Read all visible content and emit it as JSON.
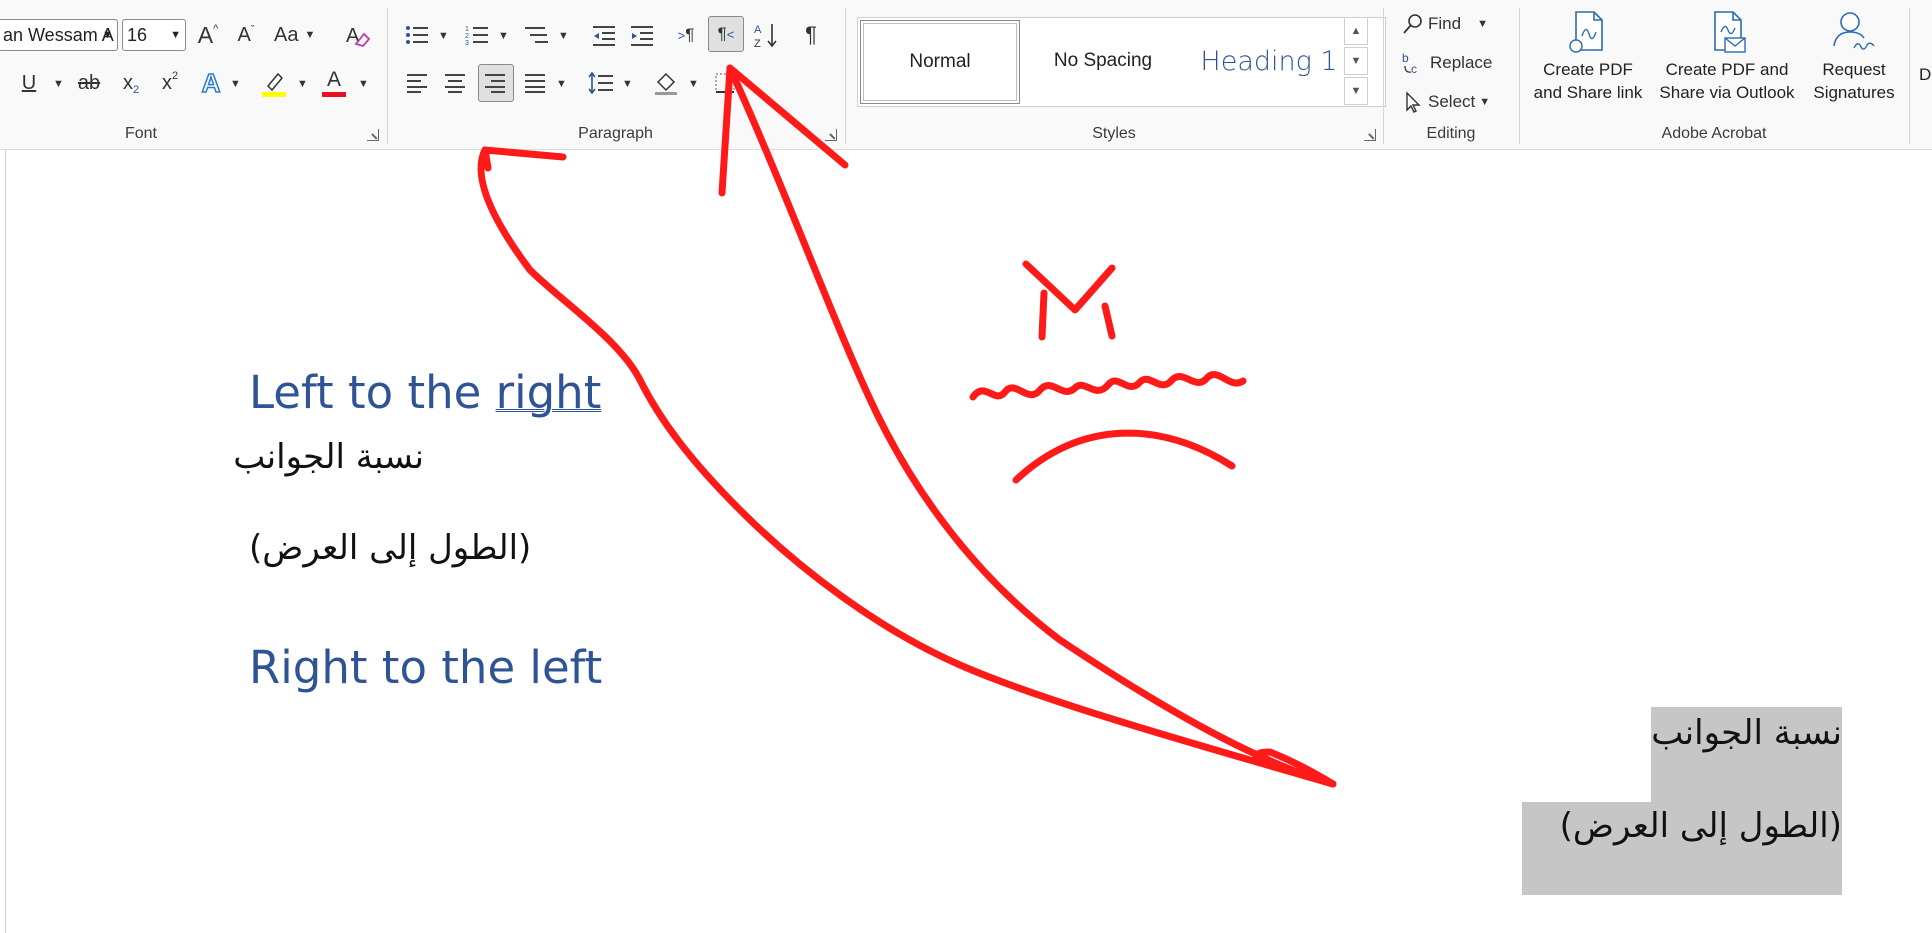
{
  "ribbon": {
    "font": {
      "group_label": "Font",
      "font_name": "an Wessam A",
      "font_size": "16",
      "grow_font": "A",
      "shrink_font": "A",
      "change_case": "Aa",
      "underline": "U",
      "strikethrough": "ab",
      "subscript": "x",
      "superscript": "x",
      "text_effects": "A",
      "font_color": "A",
      "colors": {
        "highlight": "#ffff00",
        "font_color": "#e81123"
      }
    },
    "paragraph": {
      "group_label": "Paragraph",
      "show_marks": "¶",
      "ltr": "¶",
      "rtl": "¶"
    },
    "styles": {
      "group_label": "Styles",
      "items": [
        {
          "label": "Normal"
        },
        {
          "label": "No Spacing"
        },
        {
          "label": "Heading 1"
        }
      ]
    },
    "editing": {
      "group_label": "Editing",
      "find": "Find",
      "replace": "Replace",
      "select": "Select"
    },
    "acrobat": {
      "group_label": "Adobe Acrobat",
      "create_share_link": [
        "Create PDF",
        "and Share link"
      ],
      "create_share_outlook": [
        "Create PDF and",
        "Share via Outlook"
      ],
      "request_signatures": [
        "Request",
        "Signatures"
      ],
      "cut_off": "D"
    }
  },
  "document": {
    "heading_ltr_prefix": "Left to the ",
    "heading_ltr_link": "right",
    "arabic_line1_ltr": "نسبة الجوانب",
    "arabic_line2_ltr": "(الطول إلى العرض)",
    "heading_rtl": "Right to the left",
    "arabic_line1_rtl": "نسبة الجوانب",
    "arabic_line2_rtl": "(الطول إلى العرض)"
  },
  "colors": {
    "heading": "#2f5496",
    "annotation": "#ff1a1a",
    "selection": "#c6c6c6"
  }
}
